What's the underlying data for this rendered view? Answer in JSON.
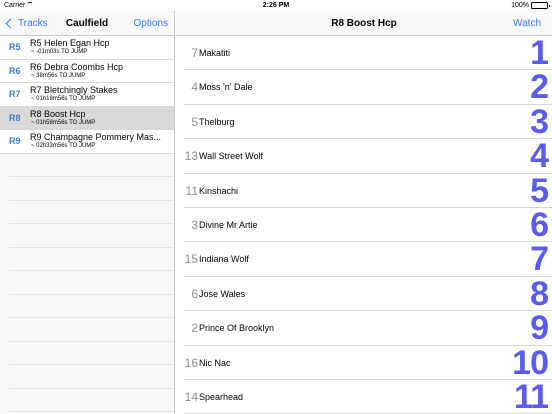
{
  "status_bar": {
    "carrier": "Carrier",
    "time": "2:26 PM",
    "battery": "100%",
    "battery_level": 1.0
  },
  "sidebar": {
    "back_label": "Tracks",
    "title": "Caulfield",
    "options_label": "Options",
    "races": [
      {
        "number": "R5",
        "name": "R5 Helen Egan Hcp",
        "jump": "~ -01m03s TO JUMP",
        "selected": false
      },
      {
        "number": "R6",
        "name": "R6 Debra Coombs Hcp",
        "jump": "~ 38m56s TO JUMP",
        "selected": false
      },
      {
        "number": "R7",
        "name": "R7 Bletchingly Stakes",
        "jump": "~ 01h18m56s TO JUMP",
        "selected": false
      },
      {
        "number": "R8",
        "name": "R8 Boost Hcp",
        "jump": "~ 01h58m56s TO JUMP",
        "selected": true
      },
      {
        "number": "R9",
        "name": "R9 Champagne Pommery Mas...",
        "jump": "~ 02h33m56s TO JUMP",
        "selected": false
      }
    ]
  },
  "main": {
    "title": "R8 Boost Hcp",
    "watch_label": "Watch",
    "runners": [
      {
        "barrier": "7",
        "horse": "Makatiti",
        "number": "1"
      },
      {
        "barrier": "4",
        "horse": "Moss 'n' Dale",
        "number": "2"
      },
      {
        "barrier": "5",
        "horse": "Thelburg",
        "number": "3"
      },
      {
        "barrier": "13",
        "horse": "Wall Street Wolf",
        "number": "4"
      },
      {
        "barrier": "11",
        "horse": "Kinshachi",
        "number": "5"
      },
      {
        "barrier": "3",
        "horse": "Divine Mr Artie",
        "number": "6"
      },
      {
        "barrier": "15",
        "horse": "Indiana Wolf",
        "number": "7"
      },
      {
        "barrier": "6",
        "horse": "Jose Wales",
        "number": "8"
      },
      {
        "barrier": "2",
        "horse": "Prince Of Brooklyn",
        "number": "9"
      },
      {
        "barrier": "16",
        "horse": "Nic Nac",
        "number": "10"
      },
      {
        "barrier": "14",
        "horse": "Spearhead",
        "number": "11"
      }
    ]
  },
  "colors": {
    "accent": "#3478f6",
    "race_number": "#3b7fc4",
    "saddle_number": "#5a5bf0",
    "selected_row": "#d9d9d9"
  },
  "icons": {
    "wifi": "wifi-icon",
    "battery": "battery-icon",
    "back": "chevron-left-icon"
  }
}
